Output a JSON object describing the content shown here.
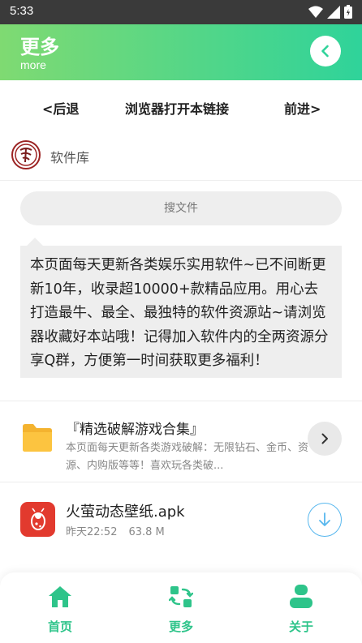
{
  "status": {
    "time": "5:33"
  },
  "header": {
    "title": "更多",
    "subtitle": "more"
  },
  "nav": {
    "back": "<后退",
    "open_in_browser": "浏览器打开本链接",
    "forward": "前进>"
  },
  "library": {
    "label": "软件库"
  },
  "search": {
    "placeholder": "搜文件"
  },
  "notice": {
    "text": "本页面每天更新各类娱乐实用软件~已不间断更新10年，收录超10000+款精品应用。用心去打造最牛、最全、最独特的软件资源站~请浏览器收藏好本站哦！记得加入软件内的全两资源分享Q群，方便第一时间获取更多福利！"
  },
  "folder": {
    "title": "『精选破解游戏合集』",
    "description": "本页面每天更新各类游戏破解：无限钻石、金币、资源、内购版等等！喜欢玩各类破..."
  },
  "file": {
    "name": "火萤动态壁纸.apk",
    "time": "昨天22:52",
    "size": "63.8 M"
  },
  "tabs": [
    {
      "label": "首页",
      "icon": "home-icon"
    },
    {
      "label": "更多",
      "icon": "swap-icon"
    },
    {
      "label": "关于",
      "icon": "user-icon"
    }
  ],
  "colors": {
    "accent": "#2ec48a",
    "header_start": "#7fda72",
    "header_end": "#2fd39a",
    "download": "#57b7ee"
  }
}
